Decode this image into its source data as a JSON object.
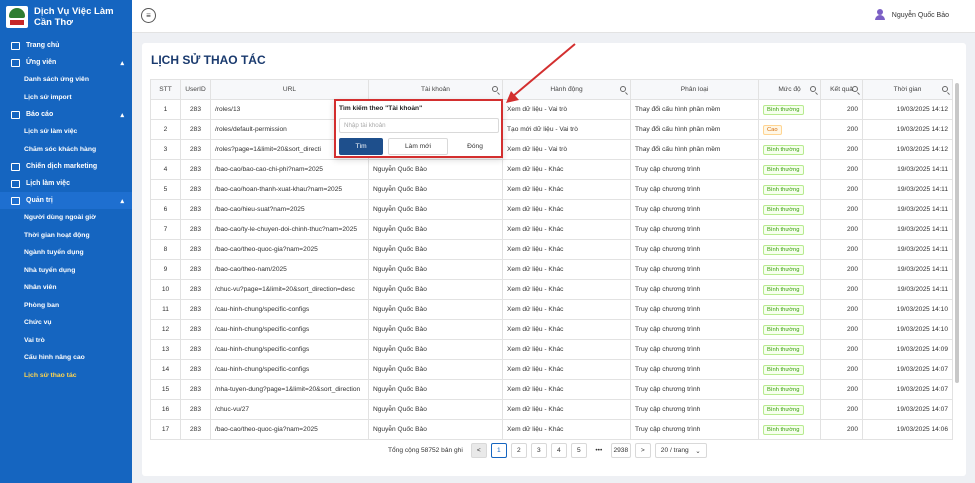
{
  "brand": {
    "line1": "Dịch Vụ Việc Làm",
    "line2": "Cần Thơ"
  },
  "sidebar": {
    "home": "Trang chủ",
    "candidates": {
      "label": "Ứng viên",
      "items": [
        "Danh sách ứng viên",
        "Lịch sử import"
      ]
    },
    "reports": {
      "label": "Báo cáo",
      "items": [
        "Lịch sử làm việc",
        "Chăm sóc khách hàng"
      ]
    },
    "marketing": "Chiến dịch marketing",
    "schedule": "Lịch làm việc",
    "admin": {
      "label": "Quản trị",
      "items": [
        "Người dùng ngoài giờ",
        "Thời gian hoạt động",
        "Ngành tuyển dụng",
        "Nhà tuyển dụng",
        "Nhân viên",
        "Phòng ban",
        "Chức vụ",
        "Vai trò",
        "Cấu hình nâng cao",
        "Lịch sử thao tác"
      ]
    }
  },
  "header": {
    "user_name": "Nguyễn Quốc Bảo"
  },
  "page": {
    "title": "LỊCH SỬ THAO TÁC"
  },
  "table": {
    "columns": [
      "STT",
      "UserID",
      "URL",
      "Tài khoản",
      "Hành động",
      "Phân loại",
      "Mức độ",
      "Kết quả",
      "Thời gian"
    ],
    "rows": [
      [
        "1",
        "283",
        "/roles/13",
        "",
        "Xem dữ liệu - Vai trò",
        "Thay đổi cấu hình phần mềm",
        "Bình thường",
        "200",
        "19/03/2025 14:12"
      ],
      [
        "2",
        "283",
        "/roles/default-permission",
        "",
        "Tạo mới dữ liệu - Vai trò",
        "Thay đổi cấu hình phần mềm",
        "Cao",
        "200",
        "19/03/2025 14:12"
      ],
      [
        "3",
        "283",
        "/roles?page=1&limit=20&sort_directi",
        "",
        "Xem dữ liệu - Vai trò",
        "Thay đổi cấu hình phần mềm",
        "Bình thường",
        "200",
        "19/03/2025 14:12"
      ],
      [
        "4",
        "283",
        "/bao-cao/bao-cao-chi-phi?nam=2025",
        "Nguyễn Quốc Bảo",
        "Xem dữ liệu - Khác",
        "Truy cập chương trình",
        "Bình thường",
        "200",
        "19/03/2025 14:11"
      ],
      [
        "5",
        "283",
        "/bao-cao/hoan-thanh-xuat-khau?nam=2025",
        "Nguyễn Quốc Bảo",
        "Xem dữ liệu - Khác",
        "Truy cập chương trình",
        "Bình thường",
        "200",
        "19/03/2025 14:11"
      ],
      [
        "6",
        "283",
        "/bao-cao/hieu-suat?nam=2025",
        "Nguyễn Quốc Bảo",
        "Xem dữ liệu - Khác",
        "Truy cập chương trình",
        "Bình thường",
        "200",
        "19/03/2025 14:11"
      ],
      [
        "7",
        "283",
        "/bao-cao/ty-le-chuyen-doi-chinh-thuc?nam=2025",
        "Nguyễn Quốc Bảo",
        "Xem dữ liệu - Khác",
        "Truy cập chương trình",
        "Bình thường",
        "200",
        "19/03/2025 14:11"
      ],
      [
        "8",
        "283",
        "/bao-cao/theo-quoc-gia?nam=2025",
        "Nguyễn Quốc Bảo",
        "Xem dữ liệu - Khác",
        "Truy cập chương trình",
        "Bình thường",
        "200",
        "19/03/2025 14:11"
      ],
      [
        "9",
        "283",
        "/bao-cao/theo-nam/2025",
        "Nguyễn Quốc Bảo",
        "Xem dữ liệu - Khác",
        "Truy cập chương trình",
        "Bình thường",
        "200",
        "19/03/2025 14:11"
      ],
      [
        "10",
        "283",
        "/chuc-vu?page=1&limit=20&sort_direction=desc",
        "Nguyễn Quốc Bảo",
        "Xem dữ liệu - Khác",
        "Truy cập chương trình",
        "Bình thường",
        "200",
        "19/03/2025 14:11"
      ],
      [
        "11",
        "283",
        "/cau-hinh-chung/specific-configs",
        "Nguyễn Quốc Bảo",
        "Xem dữ liệu - Khác",
        "Truy cập chương trình",
        "Bình thường",
        "200",
        "19/03/2025 14:10"
      ],
      [
        "12",
        "283",
        "/cau-hinh-chung/specific-configs",
        "Nguyễn Quốc Bảo",
        "Xem dữ liệu - Khác",
        "Truy cập chương trình",
        "Bình thường",
        "200",
        "19/03/2025 14:10"
      ],
      [
        "13",
        "283",
        "/cau-hinh-chung/specific-configs",
        "Nguyễn Quốc Bảo",
        "Xem dữ liệu - Khác",
        "Truy cập chương trình",
        "Bình thường",
        "200",
        "19/03/2025 14:09"
      ],
      [
        "14",
        "283",
        "/cau-hinh-chung/specific-configs",
        "Nguyễn Quốc Bảo",
        "Xem dữ liệu - Khác",
        "Truy cập chương trình",
        "Bình thường",
        "200",
        "19/03/2025 14:07"
      ],
      [
        "15",
        "283",
        "/nha-tuyen-dung?page=1&limit=20&sort_direction",
        "Nguyễn Quốc Bảo",
        "Xem dữ liệu - Khác",
        "Truy cập chương trình",
        "Bình thường",
        "200",
        "19/03/2025 14:07"
      ],
      [
        "16",
        "283",
        "/chuc-vu/27",
        "Nguyễn Quốc Bảo",
        "Xem dữ liệu - Khác",
        "Truy cập chương trình",
        "Bình thường",
        "200",
        "19/03/2025 14:07"
      ],
      [
        "17",
        "283",
        "/bao-cao/theo-quoc-gia?nam=2025",
        "Nguyễn Quốc Bảo",
        "Xem dữ liệu - Khác",
        "Truy cập chương trình",
        "Bình thường",
        "200",
        "19/03/2025 14:06"
      ]
    ]
  },
  "pagination": {
    "total": "Tổng cộng 58752 bản ghi",
    "prev": "<",
    "pages": [
      "1",
      "2",
      "3",
      "4",
      "5"
    ],
    "ellipsis": "•••",
    "last": "2938",
    "next": ">",
    "page_size": "20 / trang"
  },
  "filter_popup": {
    "title": "Tìm kiếm theo \"Tài khoản\"",
    "placeholder": "Nhập tài khoản",
    "find": "Tìm",
    "reset": "Làm mới",
    "close": "Đóng"
  },
  "colors": {
    "sidebar": "#1565c0",
    "highlight": "#d32f2f",
    "primary_button": "#1e4f8c",
    "active_nav": "#ffd54f"
  }
}
